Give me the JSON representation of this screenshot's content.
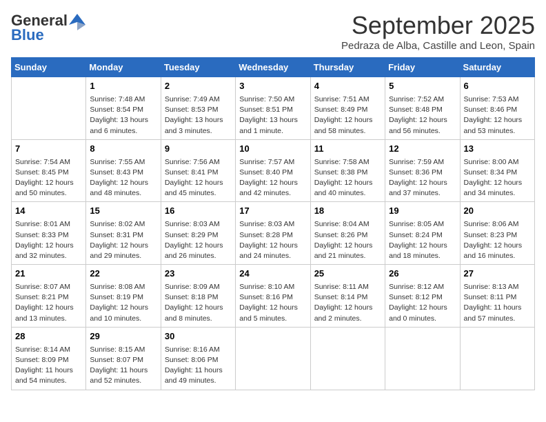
{
  "header": {
    "logo_line1": "General",
    "logo_line2": "Blue",
    "month": "September 2025",
    "location": "Pedraza de Alba, Castille and Leon, Spain"
  },
  "days_of_week": [
    "Sunday",
    "Monday",
    "Tuesday",
    "Wednesday",
    "Thursday",
    "Friday",
    "Saturday"
  ],
  "weeks": [
    [
      {
        "day": "",
        "content": ""
      },
      {
        "day": "1",
        "content": "Sunrise: 7:48 AM\nSunset: 8:54 PM\nDaylight: 13 hours\nand 6 minutes."
      },
      {
        "day": "2",
        "content": "Sunrise: 7:49 AM\nSunset: 8:53 PM\nDaylight: 13 hours\nand 3 minutes."
      },
      {
        "day": "3",
        "content": "Sunrise: 7:50 AM\nSunset: 8:51 PM\nDaylight: 13 hours\nand 1 minute."
      },
      {
        "day": "4",
        "content": "Sunrise: 7:51 AM\nSunset: 8:49 PM\nDaylight: 12 hours\nand 58 minutes."
      },
      {
        "day": "5",
        "content": "Sunrise: 7:52 AM\nSunset: 8:48 PM\nDaylight: 12 hours\nand 56 minutes."
      },
      {
        "day": "6",
        "content": "Sunrise: 7:53 AM\nSunset: 8:46 PM\nDaylight: 12 hours\nand 53 minutes."
      }
    ],
    [
      {
        "day": "7",
        "content": "Sunrise: 7:54 AM\nSunset: 8:45 PM\nDaylight: 12 hours\nand 50 minutes."
      },
      {
        "day": "8",
        "content": "Sunrise: 7:55 AM\nSunset: 8:43 PM\nDaylight: 12 hours\nand 48 minutes."
      },
      {
        "day": "9",
        "content": "Sunrise: 7:56 AM\nSunset: 8:41 PM\nDaylight: 12 hours\nand 45 minutes."
      },
      {
        "day": "10",
        "content": "Sunrise: 7:57 AM\nSunset: 8:40 PM\nDaylight: 12 hours\nand 42 minutes."
      },
      {
        "day": "11",
        "content": "Sunrise: 7:58 AM\nSunset: 8:38 PM\nDaylight: 12 hours\nand 40 minutes."
      },
      {
        "day": "12",
        "content": "Sunrise: 7:59 AM\nSunset: 8:36 PM\nDaylight: 12 hours\nand 37 minutes."
      },
      {
        "day": "13",
        "content": "Sunrise: 8:00 AM\nSunset: 8:34 PM\nDaylight: 12 hours\nand 34 minutes."
      }
    ],
    [
      {
        "day": "14",
        "content": "Sunrise: 8:01 AM\nSunset: 8:33 PM\nDaylight: 12 hours\nand 32 minutes."
      },
      {
        "day": "15",
        "content": "Sunrise: 8:02 AM\nSunset: 8:31 PM\nDaylight: 12 hours\nand 29 minutes."
      },
      {
        "day": "16",
        "content": "Sunrise: 8:03 AM\nSunset: 8:29 PM\nDaylight: 12 hours\nand 26 minutes."
      },
      {
        "day": "17",
        "content": "Sunrise: 8:03 AM\nSunset: 8:28 PM\nDaylight: 12 hours\nand 24 minutes."
      },
      {
        "day": "18",
        "content": "Sunrise: 8:04 AM\nSunset: 8:26 PM\nDaylight: 12 hours\nand 21 minutes."
      },
      {
        "day": "19",
        "content": "Sunrise: 8:05 AM\nSunset: 8:24 PM\nDaylight: 12 hours\nand 18 minutes."
      },
      {
        "day": "20",
        "content": "Sunrise: 8:06 AM\nSunset: 8:23 PM\nDaylight: 12 hours\nand 16 minutes."
      }
    ],
    [
      {
        "day": "21",
        "content": "Sunrise: 8:07 AM\nSunset: 8:21 PM\nDaylight: 12 hours\nand 13 minutes."
      },
      {
        "day": "22",
        "content": "Sunrise: 8:08 AM\nSunset: 8:19 PM\nDaylight: 12 hours\nand 10 minutes."
      },
      {
        "day": "23",
        "content": "Sunrise: 8:09 AM\nSunset: 8:18 PM\nDaylight: 12 hours\nand 8 minutes."
      },
      {
        "day": "24",
        "content": "Sunrise: 8:10 AM\nSunset: 8:16 PM\nDaylight: 12 hours\nand 5 minutes."
      },
      {
        "day": "25",
        "content": "Sunrise: 8:11 AM\nSunset: 8:14 PM\nDaylight: 12 hours\nand 2 minutes."
      },
      {
        "day": "26",
        "content": "Sunrise: 8:12 AM\nSunset: 8:12 PM\nDaylight: 12 hours\nand 0 minutes."
      },
      {
        "day": "27",
        "content": "Sunrise: 8:13 AM\nSunset: 8:11 PM\nDaylight: 11 hours\nand 57 minutes."
      }
    ],
    [
      {
        "day": "28",
        "content": "Sunrise: 8:14 AM\nSunset: 8:09 PM\nDaylight: 11 hours\nand 54 minutes."
      },
      {
        "day": "29",
        "content": "Sunrise: 8:15 AM\nSunset: 8:07 PM\nDaylight: 11 hours\nand 52 minutes."
      },
      {
        "day": "30",
        "content": "Sunrise: 8:16 AM\nSunset: 8:06 PM\nDaylight: 11 hours\nand 49 minutes."
      },
      {
        "day": "",
        "content": ""
      },
      {
        "day": "",
        "content": ""
      },
      {
        "day": "",
        "content": ""
      },
      {
        "day": "",
        "content": ""
      }
    ]
  ]
}
